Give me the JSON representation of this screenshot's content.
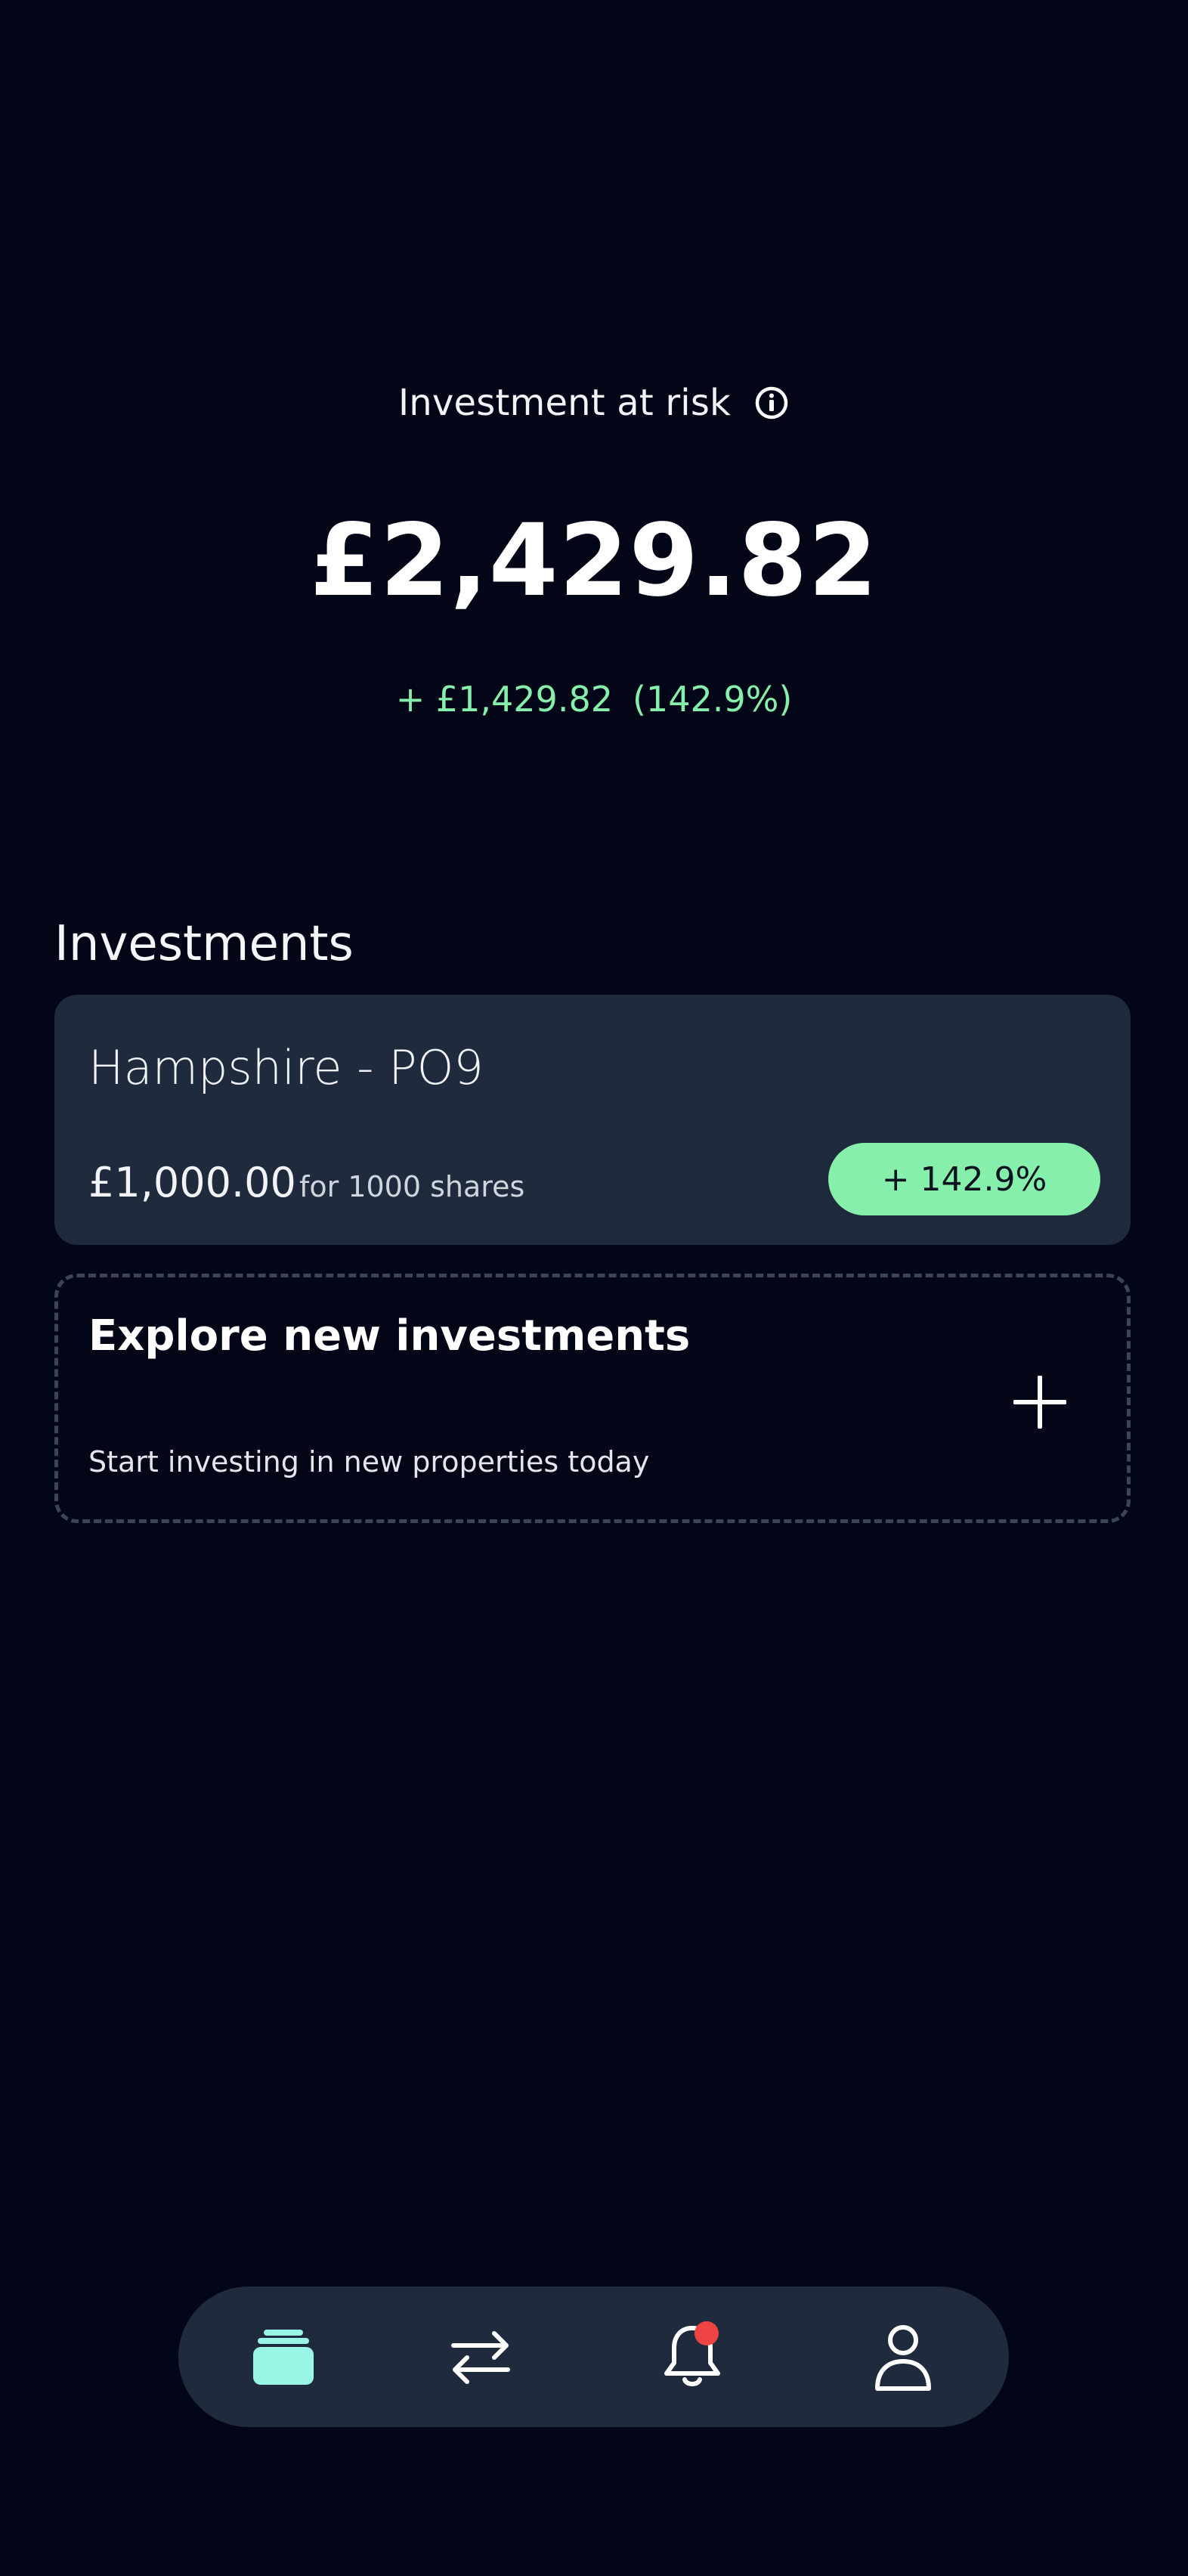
{
  "summary": {
    "label": "Investment at risk",
    "info_icon": "info-icon",
    "total_value": "£2,429.82",
    "gain_amount": "+ £1,429.82",
    "gain_percent": "(142.9%)"
  },
  "investments": {
    "section_title": "Investments",
    "items": [
      {
        "name": "Hampshire - PO9",
        "amount": "£1,000.00",
        "shares_text": "for 1000 shares",
        "change_badge": "+ 142.9%"
      }
    ]
  },
  "explore": {
    "title": "Explore new investments",
    "subtitle": "Start investing in new properties today",
    "icon": "plus-icon"
  },
  "tabbar": {
    "tabs": [
      {
        "icon": "portfolio-stack-icon",
        "active": true
      },
      {
        "icon": "transfer-arrows-icon",
        "active": false
      },
      {
        "icon": "bell-icon",
        "active": false,
        "has_notification": true
      },
      {
        "icon": "profile-icon",
        "active": false
      }
    ]
  },
  "colors": {
    "background": "#030617",
    "card": "#1f2a3c",
    "accent_green": "#86efac",
    "active_tab": "#99f6e4",
    "notification": "#ef4444"
  }
}
